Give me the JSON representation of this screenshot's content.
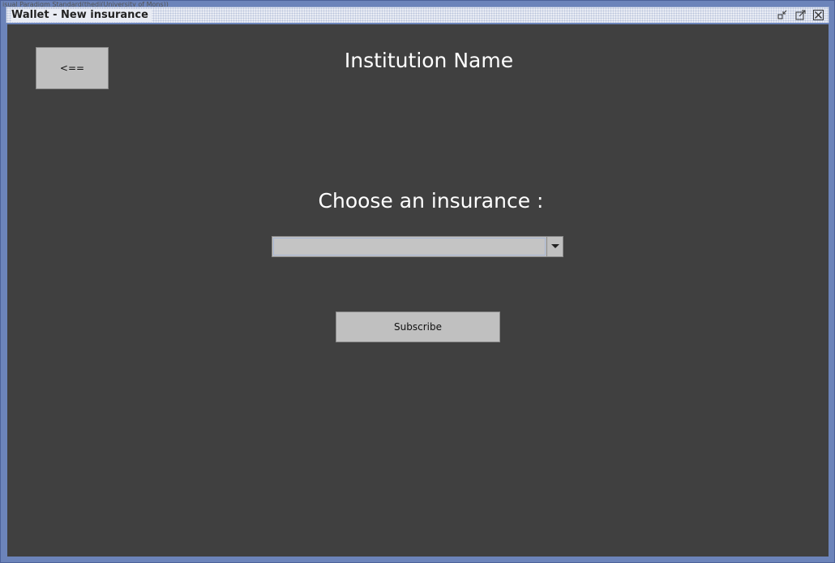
{
  "window": {
    "watermark": "isual Paradigm Standard(thedi(University of Mons))",
    "title": "Wallet - New insurance",
    "buttons": [
      {
        "name": "minimize",
        "icon": "minimize-icon"
      },
      {
        "name": "maximize",
        "icon": "maximize-icon"
      },
      {
        "name": "close",
        "icon": "close-icon"
      }
    ]
  },
  "page": {
    "back_label": "<==",
    "institution_name": "Institution Name",
    "choose_label": "Choose an insurance :",
    "insurance_select": {
      "selected_value": "",
      "arrow_icon": "chevron-down-icon"
    },
    "subscribe_label": "Subscribe"
  },
  "colors": {
    "background": "#404040",
    "frame": "#6c84ba",
    "button": "#c0c0c0",
    "text_light": "#ffffff"
  }
}
